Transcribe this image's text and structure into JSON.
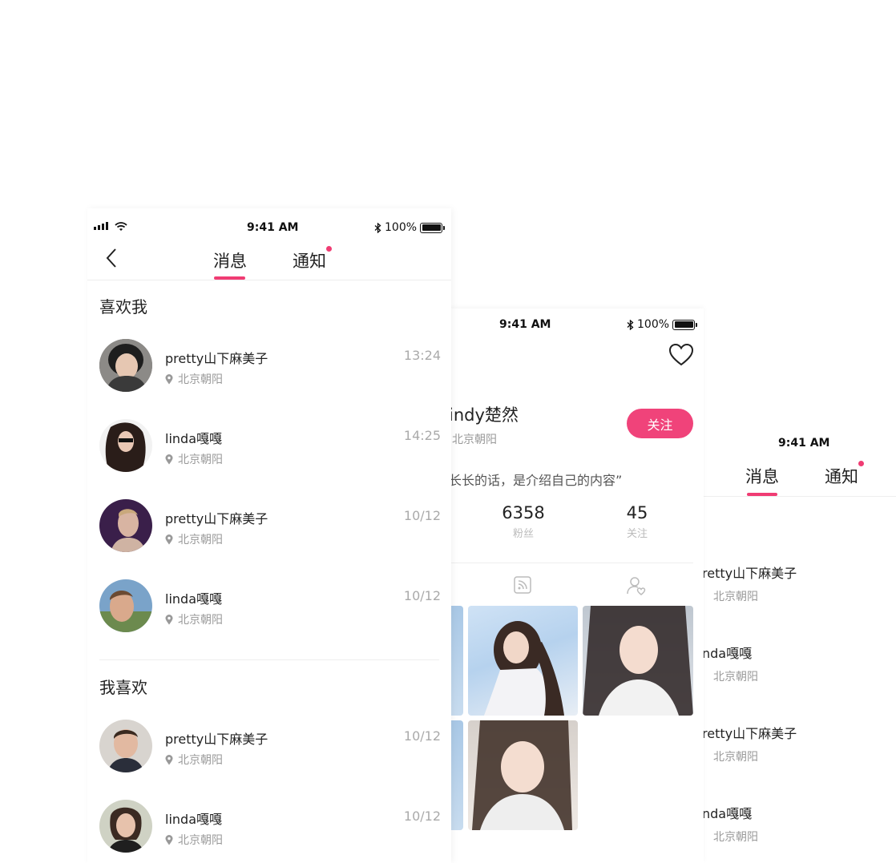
{
  "colors": {
    "accent": "#f03c73",
    "follow_button": "#f0437a",
    "text": "#222222",
    "muted": "#999999"
  },
  "screen1": {
    "status": {
      "time": "9:41 AM",
      "battery": "100%"
    },
    "nav": {
      "back_icon": "chevron-left-icon",
      "tab_messages": "消息",
      "tab_notifications": "通知"
    },
    "sections": [
      {
        "title": "喜欢我",
        "items": [
          {
            "name": "pretty山下麻美子",
            "location": "北京朝阳",
            "time": "13:24"
          },
          {
            "name": "linda嘎嘎",
            "location": "北京朝阳",
            "time": "14:25"
          },
          {
            "name": "pretty山下麻美子",
            "location": "北京朝阳",
            "time": "10/12"
          },
          {
            "name": "linda嘎嘎",
            "location": "北京朝阳",
            "time": "10/12"
          }
        ]
      },
      {
        "title": "我喜欢",
        "items": [
          {
            "name": "pretty山下麻美子",
            "location": "北京朝阳",
            "time": "10/12"
          },
          {
            "name": "linda嘎嘎",
            "location": "北京朝阳",
            "time": "10/12"
          }
        ]
      }
    ]
  },
  "screen2": {
    "status": {
      "time": "9:41 AM",
      "battery": "100%"
    },
    "profile": {
      "name": "indy楚然",
      "location": "北京朝阳",
      "follow_label": "关注",
      "bio": "长长的话，是介绍自己的内容”",
      "stats": [
        {
          "value": "6358",
          "label": "粉丝"
        },
        {
          "value": "45",
          "label": "关注"
        }
      ]
    },
    "tab_icons": [
      "feed-icon",
      "user-heart-icon"
    ]
  },
  "screen3": {
    "status": {
      "time": "9:41 AM"
    },
    "nav": {
      "tab_messages": "消息",
      "tab_notifications": "通知"
    },
    "items": [
      {
        "name": "retty山下麻美子",
        "location": "北京朝阳"
      },
      {
        "name": "nda嘎嘎",
        "location": "北京朝阳"
      },
      {
        "name": "retty山下麻美子",
        "location": "北京朝阳"
      },
      {
        "name": "nda嘎嘎",
        "location": "北京朝阳"
      }
    ]
  }
}
